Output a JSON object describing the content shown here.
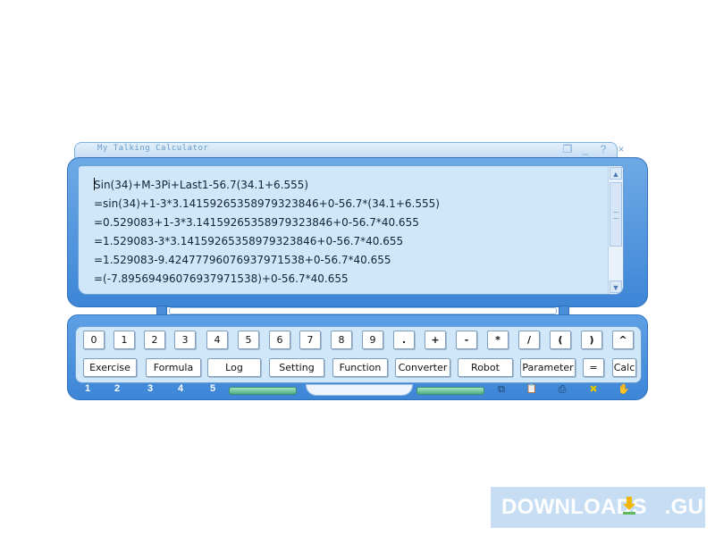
{
  "window": {
    "title": "My Talking Calculator",
    "controls": {
      "restore": "❐",
      "minimize": "_",
      "help": "?",
      "close": "×"
    }
  },
  "display": {
    "lines": [
      "Sin(34)+M-3Pi+Last1-56.7(34.1+6.555)",
      "=sin(34)+1-3*3.14159265358979323846+0-56.7*(34.1+6.555)",
      "=0.529083+1-3*3.14159265358979323846+0-56.7*40.655",
      "=1.529083-3*3.14159265358979323846+0-56.7*40.655",
      "=1.529083-9.42477796076937971538+0-56.7*40.655",
      "=(-7.89569496076937971538)+0-56.7*40.655"
    ],
    "scroll_up": "▲",
    "scroll_down": "▼"
  },
  "keypad": {
    "row1": [
      "0",
      "1",
      "2",
      "3",
      "4",
      "5",
      "6",
      "7",
      "8",
      "9",
      ".",
      "+",
      "-",
      "*",
      "/",
      "(",
      ")",
      "^"
    ],
    "row2": [
      "Exercise",
      "Formula",
      "Log",
      "Setting",
      "Function",
      "Converter",
      "Robot",
      "Parameter",
      "=",
      "Calc"
    ]
  },
  "bottom": {
    "pages": [
      "1",
      "2",
      "3",
      "4",
      "5"
    ],
    "icons": [
      {
        "name": "copy-icon",
        "glyph": "⧉"
      },
      {
        "name": "paste-icon",
        "glyph": "📋"
      },
      {
        "name": "print-icon",
        "glyph": "⎙"
      },
      {
        "name": "clear-icon",
        "glyph": "✖"
      },
      {
        "name": "hand-icon",
        "glyph": "✋"
      }
    ]
  },
  "watermark": {
    "text_left": "DOWNLOADS",
    "text_right": ".GURU"
  },
  "colors": {
    "frame": "#3d86d6",
    "display_bg": "#cfe7f8",
    "accent_green": "#4fae84",
    "clear_icon": "#e0c400"
  }
}
